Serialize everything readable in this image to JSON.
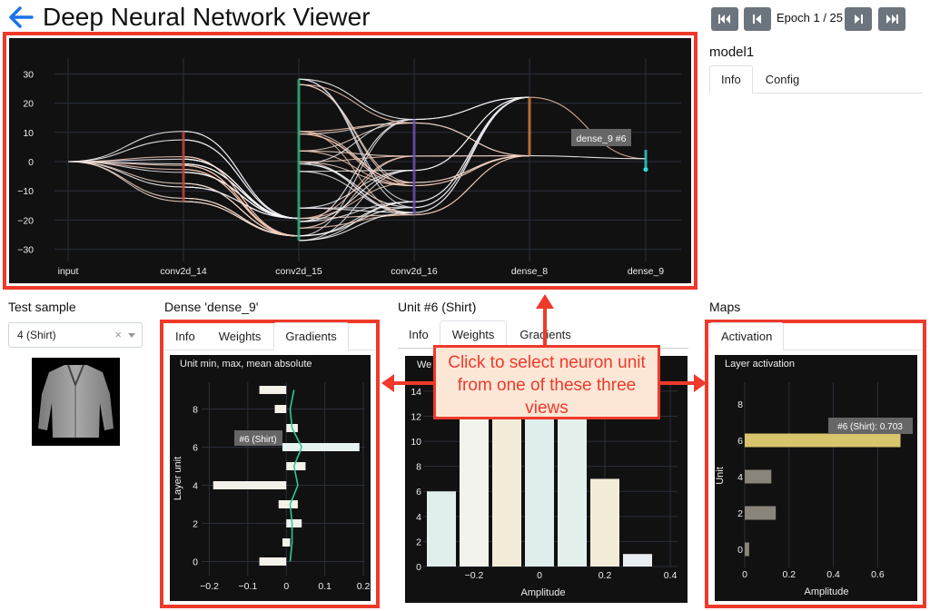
{
  "app": {
    "title": "Deep Neural Network Viewer"
  },
  "toolbar": {
    "epoch_label": "Epoch 1 / 25"
  },
  "model": {
    "name": "model1",
    "tabs": [
      "Info",
      "Config"
    ],
    "active_tab": "Info"
  },
  "network_graph": {
    "layers": [
      "input",
      "conv2d_14",
      "conv2d_15",
      "conv2d_16",
      "dense_8",
      "dense_9"
    ],
    "y_ticks": [
      "30",
      "20",
      "10",
      "0",
      "−10",
      "−20",
      "−30"
    ],
    "tooltip": "dense_9 #6"
  },
  "test_sample": {
    "title": "Test sample",
    "selected": "4 (Shirt)",
    "clear": "×"
  },
  "dense_panel": {
    "title": "Dense 'dense_9'",
    "tabs": [
      "Info",
      "Weights",
      "Gradients"
    ],
    "active_tab": "Gradients",
    "plot_title": "Unit min, max, mean absolute",
    "ylabel": "Layer unit",
    "y_ticks": [
      "8",
      "6",
      "4",
      "2",
      "0"
    ],
    "x_ticks": [
      "−0.2",
      "−0.1",
      "0",
      "0.1",
      "0.2"
    ],
    "tooltip": "#6 (Shirt)"
  },
  "unit_panel": {
    "title": "Unit #6 (Shirt)",
    "tabs": [
      "Info",
      "Weights",
      "Gradients"
    ],
    "active_tab": "Weights",
    "plot_title": "We",
    "y_ticks": [
      "14",
      "12",
      "10",
      "8",
      "6",
      "4",
      "2",
      "0"
    ],
    "x_ticks": [
      "−0.2",
      "0",
      "0.2",
      "0.4"
    ],
    "xlabel": "Amplitude"
  },
  "maps_panel": {
    "title": "Maps",
    "tabs": [
      "Activation"
    ],
    "active_tab": "Activation",
    "plot_title": "Layer activation",
    "ylabel": "Unit",
    "y_ticks": [
      "8",
      "6",
      "4",
      "2",
      "0"
    ],
    "x_ticks": [
      "0",
      "0.2",
      "0.4",
      "0.6"
    ],
    "xlabel": "Amplitude",
    "tooltip": "#6 (Shirt): 0.703"
  },
  "callout": {
    "text": "Click to select neuron unit from one of these three views"
  },
  "colors": {
    "accent": "#ee3a2a",
    "dark_bg": "#111111",
    "back_arrow": "#1a73e8",
    "highlight_bar": "#d8c46c"
  },
  "chart_data": [
    {
      "type": "bar",
      "orientation": "horizontal",
      "title": "Unit min, max, mean absolute",
      "ylabel": "Layer unit",
      "categories": [
        0,
        1,
        2,
        3,
        4,
        5,
        6,
        7,
        8,
        9
      ],
      "series": [
        {
          "values_min": [
            -0.07,
            -0.01,
            0,
            -0.02,
            -0.19,
            0,
            -0.01,
            0,
            -0.03,
            -0.07
          ],
          "values_max": [
            0,
            0.01,
            0.04,
            0.03,
            0,
            0.05,
            0.19,
            0.03,
            0,
            0
          ]
        }
      ],
      "mean_abs": [
        0.01,
        0.015,
        0.015,
        0.01,
        0.03,
        0.02,
        0.04,
        0.015,
        0.01,
        0.02
      ],
      "xlim": [
        -0.22,
        0.2
      ],
      "ylim": [
        -0.5,
        9.5
      ]
    },
    {
      "type": "bar",
      "title": "We",
      "xlabel": "Amplitude",
      "x": [
        -0.3,
        -0.2,
        -0.1,
        0,
        0.1,
        0.2,
        0.3
      ],
      "values": [
        6,
        14,
        14,
        14,
        14,
        7,
        1
      ],
      "bin_width": 0.1,
      "xlim": [
        -0.35,
        0.4
      ],
      "ylim": [
        0,
        14.5
      ]
    },
    {
      "type": "bar",
      "orientation": "horizontal",
      "title": "Layer activation",
      "xlabel": "Amplitude",
      "ylabel": "Unit",
      "categories": [
        0,
        2,
        4,
        6
      ],
      "values": [
        0.02,
        0.14,
        0.12,
        0.703
      ],
      "xlim": [
        0,
        0.75
      ],
      "ylim": [
        -0.5,
        9.5
      ]
    }
  ]
}
